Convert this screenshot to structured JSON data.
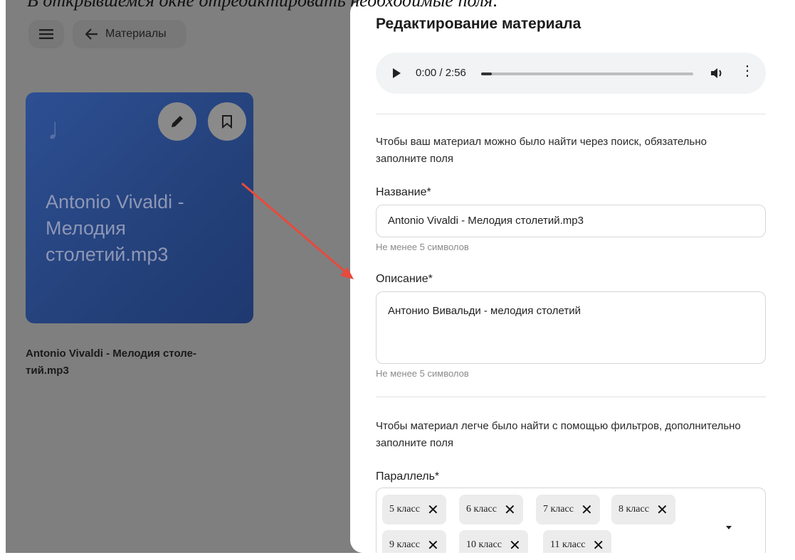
{
  "caption": "В открывшемся окне отредактировать необходимые поля:",
  "colors": {
    "accent_arrow": "#e84a3c",
    "card_bg": "#2d4f93",
    "overlay": "#7f7f7f"
  },
  "topbar": {
    "menu_icon": "hamburger-icon",
    "back_icon": "arrow-left-icon",
    "back_label": "Материалы"
  },
  "card": {
    "icon": "music-note-icon",
    "edit_icon": "pencil-icon",
    "bookmark_icon": "bookmark-icon",
    "title": "Antonio Vivaldi - Мелодия столетий.mp3",
    "caption": "Antonio Vivaldi - Мелодия столе-тий.mp3"
  },
  "modal": {
    "title": "Редактирование материала",
    "player": {
      "play_icon": "play-icon",
      "time": "0:00 / 2:56",
      "progress": 0.05,
      "volume_icon": "volume-icon",
      "more_icon": "more-vertical-icon"
    },
    "search_hint": "Чтобы ваш материал можно было найти через поиск, обязательно заполните поля",
    "name": {
      "label": "Название*",
      "value": "Antonio Vivaldi - Мелодия столетий.mp3",
      "helper": "Не менее 5 символов"
    },
    "description": {
      "label": "Описание*",
      "value": "Антонио Вивальди - мелодия столетий",
      "helper": "Не менее 5 символов"
    },
    "filter_hint": "Чтобы материал легче было найти с помощью фильтров, дополнительно заполните поля",
    "parallel": {
      "label": "Параллель*",
      "chips": [
        "5 класс",
        "6 класс",
        "7 класс",
        "8 класс",
        "9 класс",
        "10 класс",
        "11 класс"
      ],
      "remove_icon": "close-icon",
      "dropdown_icon": "caret-down-icon"
    }
  }
}
